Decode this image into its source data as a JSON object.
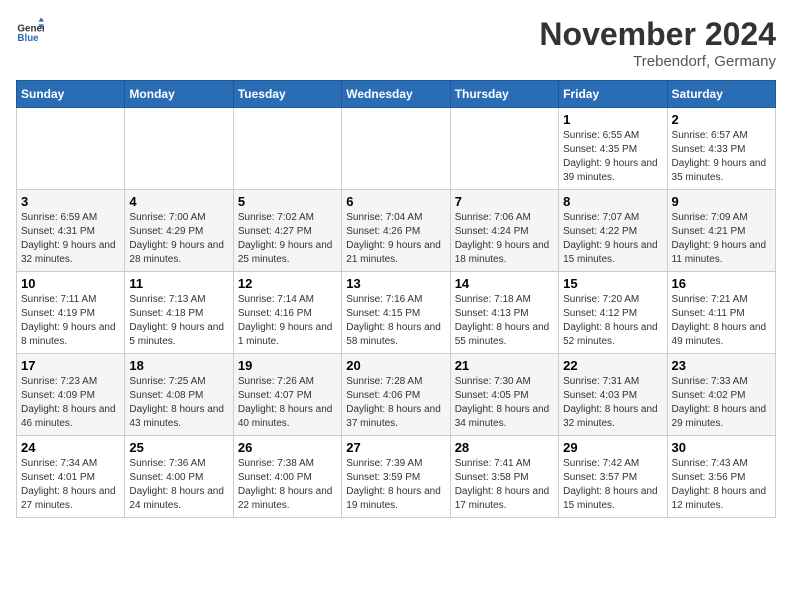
{
  "header": {
    "logo_general": "General",
    "logo_blue": "Blue",
    "month_title": "November 2024",
    "location": "Trebendorf, Germany"
  },
  "columns": [
    "Sunday",
    "Monday",
    "Tuesday",
    "Wednesday",
    "Thursday",
    "Friday",
    "Saturday"
  ],
  "weeks": [
    [
      {
        "day": "",
        "info": ""
      },
      {
        "day": "",
        "info": ""
      },
      {
        "day": "",
        "info": ""
      },
      {
        "day": "",
        "info": ""
      },
      {
        "day": "",
        "info": ""
      },
      {
        "day": "1",
        "info": "Sunrise: 6:55 AM\nSunset: 4:35 PM\nDaylight: 9 hours and 39 minutes."
      },
      {
        "day": "2",
        "info": "Sunrise: 6:57 AM\nSunset: 4:33 PM\nDaylight: 9 hours and 35 minutes."
      }
    ],
    [
      {
        "day": "3",
        "info": "Sunrise: 6:59 AM\nSunset: 4:31 PM\nDaylight: 9 hours and 32 minutes."
      },
      {
        "day": "4",
        "info": "Sunrise: 7:00 AM\nSunset: 4:29 PM\nDaylight: 9 hours and 28 minutes."
      },
      {
        "day": "5",
        "info": "Sunrise: 7:02 AM\nSunset: 4:27 PM\nDaylight: 9 hours and 25 minutes."
      },
      {
        "day": "6",
        "info": "Sunrise: 7:04 AM\nSunset: 4:26 PM\nDaylight: 9 hours and 21 minutes."
      },
      {
        "day": "7",
        "info": "Sunrise: 7:06 AM\nSunset: 4:24 PM\nDaylight: 9 hours and 18 minutes."
      },
      {
        "day": "8",
        "info": "Sunrise: 7:07 AM\nSunset: 4:22 PM\nDaylight: 9 hours and 15 minutes."
      },
      {
        "day": "9",
        "info": "Sunrise: 7:09 AM\nSunset: 4:21 PM\nDaylight: 9 hours and 11 minutes."
      }
    ],
    [
      {
        "day": "10",
        "info": "Sunrise: 7:11 AM\nSunset: 4:19 PM\nDaylight: 9 hours and 8 minutes."
      },
      {
        "day": "11",
        "info": "Sunrise: 7:13 AM\nSunset: 4:18 PM\nDaylight: 9 hours and 5 minutes."
      },
      {
        "day": "12",
        "info": "Sunrise: 7:14 AM\nSunset: 4:16 PM\nDaylight: 9 hours and 1 minute."
      },
      {
        "day": "13",
        "info": "Sunrise: 7:16 AM\nSunset: 4:15 PM\nDaylight: 8 hours and 58 minutes."
      },
      {
        "day": "14",
        "info": "Sunrise: 7:18 AM\nSunset: 4:13 PM\nDaylight: 8 hours and 55 minutes."
      },
      {
        "day": "15",
        "info": "Sunrise: 7:20 AM\nSunset: 4:12 PM\nDaylight: 8 hours and 52 minutes."
      },
      {
        "day": "16",
        "info": "Sunrise: 7:21 AM\nSunset: 4:11 PM\nDaylight: 8 hours and 49 minutes."
      }
    ],
    [
      {
        "day": "17",
        "info": "Sunrise: 7:23 AM\nSunset: 4:09 PM\nDaylight: 8 hours and 46 minutes."
      },
      {
        "day": "18",
        "info": "Sunrise: 7:25 AM\nSunset: 4:08 PM\nDaylight: 8 hours and 43 minutes."
      },
      {
        "day": "19",
        "info": "Sunrise: 7:26 AM\nSunset: 4:07 PM\nDaylight: 8 hours and 40 minutes."
      },
      {
        "day": "20",
        "info": "Sunrise: 7:28 AM\nSunset: 4:06 PM\nDaylight: 8 hours and 37 minutes."
      },
      {
        "day": "21",
        "info": "Sunrise: 7:30 AM\nSunset: 4:05 PM\nDaylight: 8 hours and 34 minutes."
      },
      {
        "day": "22",
        "info": "Sunrise: 7:31 AM\nSunset: 4:03 PM\nDaylight: 8 hours and 32 minutes."
      },
      {
        "day": "23",
        "info": "Sunrise: 7:33 AM\nSunset: 4:02 PM\nDaylight: 8 hours and 29 minutes."
      }
    ],
    [
      {
        "day": "24",
        "info": "Sunrise: 7:34 AM\nSunset: 4:01 PM\nDaylight: 8 hours and 27 minutes."
      },
      {
        "day": "25",
        "info": "Sunrise: 7:36 AM\nSunset: 4:00 PM\nDaylight: 8 hours and 24 minutes."
      },
      {
        "day": "26",
        "info": "Sunrise: 7:38 AM\nSunset: 4:00 PM\nDaylight: 8 hours and 22 minutes."
      },
      {
        "day": "27",
        "info": "Sunrise: 7:39 AM\nSunset: 3:59 PM\nDaylight: 8 hours and 19 minutes."
      },
      {
        "day": "28",
        "info": "Sunrise: 7:41 AM\nSunset: 3:58 PM\nDaylight: 8 hours and 17 minutes."
      },
      {
        "day": "29",
        "info": "Sunrise: 7:42 AM\nSunset: 3:57 PM\nDaylight: 8 hours and 15 minutes."
      },
      {
        "day": "30",
        "info": "Sunrise: 7:43 AM\nSunset: 3:56 PM\nDaylight: 8 hours and 12 minutes."
      }
    ]
  ]
}
